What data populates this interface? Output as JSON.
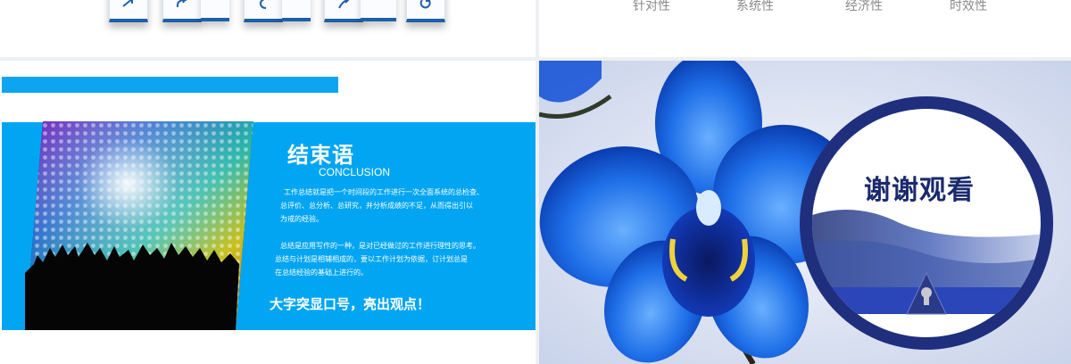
{
  "slide_top_left": {
    "icons": [
      "arrow-icon",
      "refresh-icon",
      "curve-arrow-icon",
      "undo-icon",
      "cycle-icon"
    ]
  },
  "slide_top_right": {
    "properties": [
      "针对性",
      "系统性",
      "经济性",
      "时效性"
    ]
  },
  "slide_conclusion": {
    "title": "结束语",
    "subtitle": "CONCLUSION",
    "paragraph1": [
      "工作总结就是把一个时间段的工作进行一次全面系统的总检查、",
      "总评价、总分析、总研究，并分析成绩的不足，从而得出引以",
      "为戒的经验。"
    ],
    "paragraph2": [
      "总结是应用写作的一种，是对已经做过的工作进行理性的思考。",
      "总结与计划是相辅相成的，要以工作计划为依据，订计划总是",
      "在总结经验的基础上进行的。"
    ],
    "slogan": "大字突显口号，亮出观点！",
    "accent_color": "#02a5f1"
  },
  "slide_thanks": {
    "title": "谢谢观看",
    "ring_color": "#1f2f7e"
  }
}
